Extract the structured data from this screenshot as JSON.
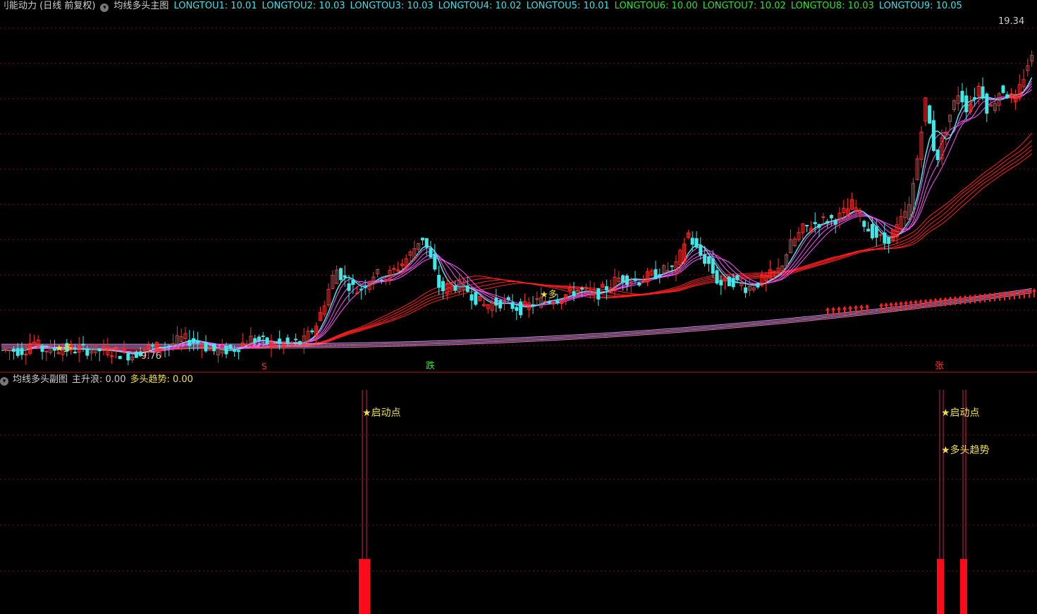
{
  "header": {
    "title": "刂能动力 (日线 前复权)",
    "indicator_icon": "down-arrow-circle-icon",
    "indicator_name": "均线多头主图",
    "values": [
      {
        "label": "LONGTOU1: 10.01",
        "color": "#3fe0e8"
      },
      {
        "label": "LONGTOU2: 10.03",
        "color": "#3fe0e8"
      },
      {
        "label": "LONGTOU3: 10.03",
        "color": "#3fe0e8"
      },
      {
        "label": "LONGTOU4: 10.02",
        "color": "#3fe0e8"
      },
      {
        "label": "LONGTOU5: 10.01",
        "color": "#3fe0e8"
      },
      {
        "label": "LONGTOU6: 10.00",
        "color": "#2ee32e"
      },
      {
        "label": "LONGTOU7: 10.02",
        "color": "#2ee32e"
      },
      {
        "label": "LONGTOU8: 10.03",
        "color": "#2ee32e"
      },
      {
        "label": "LONGTOU9: 10.05",
        "color": "#3fe0e8"
      }
    ]
  },
  "sub_header": {
    "indicator_icon": "down-arrow-circle-icon",
    "indicator_name": "均线多头副图",
    "main_wave": "主升浪: 0.00",
    "bull_trend": "多头趋势: 0.00"
  },
  "chart_data": [
    {
      "type": "candlestick",
      "price_range": [
        9.4,
        19.6
      ],
      "high_label": "19.34",
      "low_label": "9.76",
      "grid": true,
      "close_path": [
        [
          0,
          10.03
        ],
        [
          35,
          10.02
        ],
        [
          45,
          10.3
        ],
        [
          60,
          10.05
        ],
        [
          85,
          10.06
        ],
        [
          120,
          10.05
        ],
        [
          150,
          10.02
        ],
        [
          188,
          9.88
        ],
        [
          205,
          10.08
        ],
        [
          240,
          10.15
        ],
        [
          258,
          10.35
        ],
        [
          282,
          10.25
        ],
        [
          302,
          10.0
        ],
        [
          330,
          10.05
        ],
        [
          355,
          10.35
        ],
        [
          390,
          10.2
        ],
        [
          430,
          10.25
        ],
        [
          450,
          10.8
        ],
        [
          476,
          12.35
        ],
        [
          495,
          11.9
        ],
        [
          508,
          11.7
        ],
        [
          530,
          12.2
        ],
        [
          548,
          12.1
        ],
        [
          570,
          12.5
        ],
        [
          584,
          12.8
        ],
        [
          598,
          13.3
        ],
        [
          608,
          12.8
        ],
        [
          625,
          11.7
        ],
        [
          640,
          11.9
        ],
        [
          660,
          11.8
        ],
        [
          685,
          11.3
        ],
        [
          710,
          11.4
        ],
        [
          740,
          11.2
        ],
        [
          760,
          11.4
        ],
        [
          790,
          11.5
        ],
        [
          820,
          11.75
        ],
        [
          845,
          11.6
        ],
        [
          880,
          12.1
        ],
        [
          905,
          12.0
        ],
        [
          935,
          12.25
        ],
        [
          960,
          12.4
        ],
        [
          975,
          13.4
        ],
        [
          990,
          12.8
        ],
        [
          1005,
          12.5
        ],
        [
          1020,
          11.9
        ],
        [
          1040,
          12.0
        ],
        [
          1060,
          11.8
        ],
        [
          1080,
          12.0
        ],
        [
          1105,
          12.3
        ],
        [
          1120,
          13.0
        ],
        [
          1140,
          13.5
        ],
        [
          1165,
          13.7
        ],
        [
          1190,
          13.8
        ],
        [
          1210,
          14.2
        ],
        [
          1230,
          13.5
        ],
        [
          1255,
          13.1
        ],
        [
          1272,
          13.5
        ],
        [
          1290,
          14.1
        ],
        [
          1300,
          15.3
        ],
        [
          1312,
          17.2
        ],
        [
          1328,
          15.4
        ],
        [
          1345,
          16.6
        ],
        [
          1360,
          17.4
        ],
        [
          1372,
          16.9
        ],
        [
          1390,
          17.6
        ],
        [
          1402,
          16.8
        ],
        [
          1420,
          17.5
        ],
        [
          1440,
          17.1
        ],
        [
          1458,
          18.2
        ],
        [
          1471,
          18.5
        ]
      ],
      "signals": {
        "bottom_labels": [
          {
            "text": "S",
            "color": "#ff3030"
          },
          {
            "text": "跌",
            "color": "#2ee32e"
          },
          {
            "text": "张",
            "color": "#ff3030"
          }
        ],
        "star_labels": [
          "★多",
          "★多"
        ]
      }
    },
    {
      "type": "bar",
      "title": "均线多头副图",
      "series": [
        {
          "name": "主升浪",
          "value": 0.0
        },
        {
          "name": "多头趋势",
          "value": 0.0
        }
      ],
      "annotations": [
        {
          "text": "★启动点",
          "color": "#f0e040"
        },
        {
          "text": "★启动点",
          "color": "#f0e040"
        },
        {
          "text": "★多头趋势",
          "color": "#f0e040"
        }
      ],
      "bars": [
        {
          "x_index": 1,
          "value": 1
        },
        {
          "x_index": 2,
          "value": 1
        },
        {
          "x_index": 3,
          "value": 1
        }
      ]
    }
  ],
  "colors": {
    "up": "#ff3030",
    "down": "#40e8e8",
    "ma_short": "#ff55ff",
    "ma_long": "#ff2020",
    "grid": "#7a1010",
    "volume": "#ff0a1a"
  }
}
